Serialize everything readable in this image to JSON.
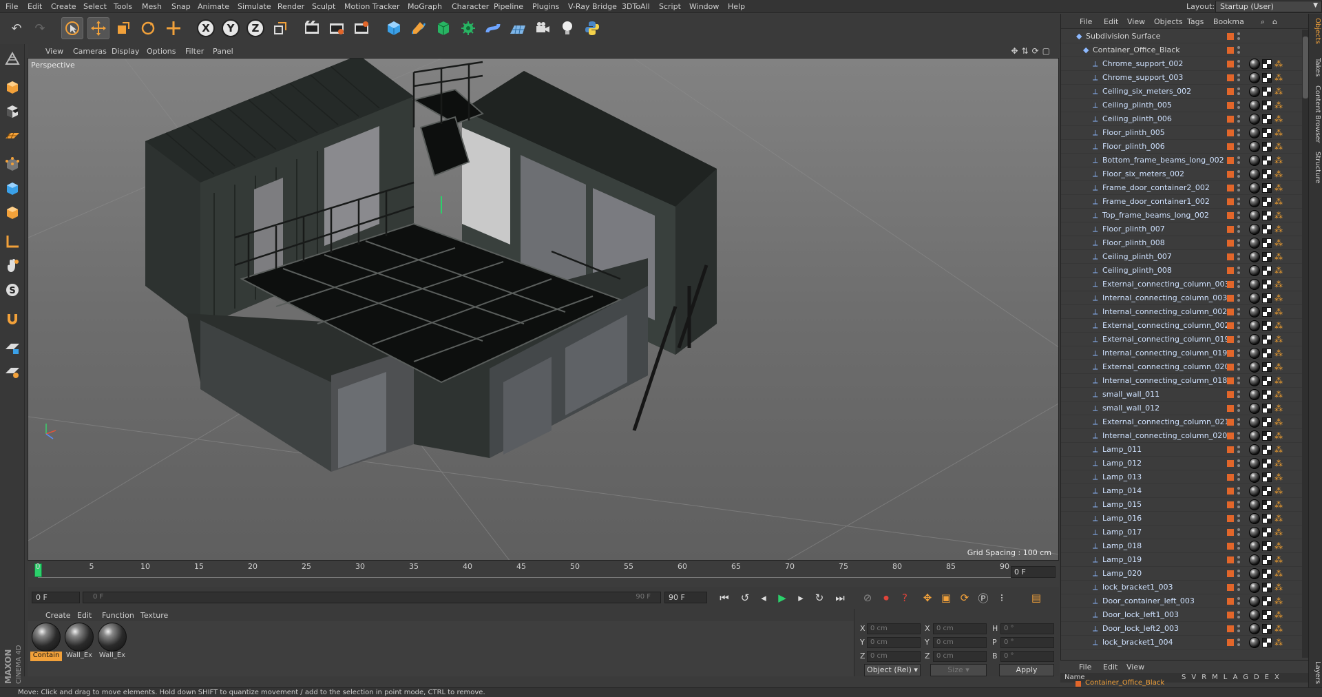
{
  "menubar": {
    "items": [
      "File",
      "Edit",
      "Create",
      "Select",
      "Tools",
      "Mesh",
      "Snap",
      "Animate",
      "Simulate",
      "Render",
      "Sculpt",
      "Motion Tracker",
      "MoGraph",
      "Character",
      "Pipeline",
      "Plugins",
      "V-Ray Bridge",
      "3DToAll",
      "Script",
      "Window",
      "Help"
    ],
    "layout_label": "Layout:",
    "layout_value": "Startup (User)"
  },
  "viewport": {
    "menu": [
      "View",
      "Cameras",
      "Display",
      "Options",
      "Filter",
      "Panel"
    ],
    "label": "Perspective",
    "grid_spacing": "Grid Spacing : 100 cm"
  },
  "timeline": {
    "ticks": [
      "0",
      "5",
      "10",
      "15",
      "20",
      "25",
      "30",
      "35",
      "40",
      "45",
      "50",
      "55",
      "60",
      "65",
      "70",
      "75",
      "80",
      "85",
      "90"
    ],
    "end_field": "0 F"
  },
  "transport": {
    "start_field": "0 F",
    "slider_left": "0 F",
    "slider_right": "90 F",
    "end_field": "90 F"
  },
  "materials": {
    "menu": [
      "Create",
      "Edit",
      "Function",
      "Texture"
    ],
    "items": [
      {
        "label": "Contain",
        "selected": true
      },
      {
        "label": "Wall_Ex",
        "selected": false
      },
      {
        "label": "Wall_Ex",
        "selected": false
      }
    ]
  },
  "attributes": {
    "rows": [
      {
        "a": "X",
        "av": "0 cm",
        "b": "X",
        "bv": "0 cm",
        "c": "H",
        "cv": "0 °"
      },
      {
        "a": "Y",
        "av": "0 cm",
        "b": "Y",
        "bv": "0 cm",
        "c": "P",
        "cv": "0 °"
      },
      {
        "a": "Z",
        "av": "0 cm",
        "b": "Z",
        "bv": "0 cm",
        "c": "B",
        "cv": "0 °"
      }
    ],
    "mode": "Object (Rel)",
    "size": "Size",
    "apply": "Apply"
  },
  "status": "Move: Click and drag to move elements. Hold down SHIFT to quantize movement / add to the selection in point mode, CTRL to remove.",
  "object_manager": {
    "menu": [
      "File",
      "Edit",
      "View",
      "Objects",
      "Tags",
      "Bookma"
    ],
    "root": "Subdivision Surface",
    "group": "Container_Office_Black",
    "objects": [
      "Chrome_support_002",
      "Chrome_support_003",
      "Ceiling_six_meters_002",
      "Ceiling_plinth_005",
      "Ceiling_plinth_006",
      "Floor_plinth_005",
      "Floor_plinth_006",
      "Bottom_frame_beams_long_002",
      "Floor_six_meters_002",
      "Frame_door_container2_002",
      "Frame_door_container1_002",
      "Top_frame_beams_long_002",
      "Floor_plinth_007",
      "Floor_plinth_008",
      "Ceiling_plinth_007",
      "Ceiling_plinth_008",
      "External_connecting_column_003",
      "Internal_connecting_column_003",
      "Internal_connecting_column_002",
      "External_connecting_column_002",
      "External_connecting_column_019",
      "Internal_connecting_column_019",
      "External_connecting_column_020",
      "Internal_connecting_column_018",
      "small_wall_011",
      "small_wall_012",
      "External_connecting_column_021",
      "Internal_connecting_column_020",
      "Lamp_011",
      "Lamp_012",
      "Lamp_013",
      "Lamp_014",
      "Lamp_015",
      "Lamp_016",
      "Lamp_017",
      "Lamp_018",
      "Lamp_019",
      "Lamp_020",
      "lock_bracket1_003",
      "Door_container_left_003",
      "Door_lock_left1_003",
      "Door_lock_left2_003",
      "lock_bracket1_004"
    ]
  },
  "layer_manager": {
    "menu": [
      "File",
      "Edit",
      "View"
    ],
    "name_header": "Name",
    "columns": "SVRMLAGDEX",
    "row": "Container_Office_Black"
  },
  "side_tabs": [
    "Objects",
    "Takes",
    "Content Browser",
    "Structure",
    "Layers"
  ]
}
